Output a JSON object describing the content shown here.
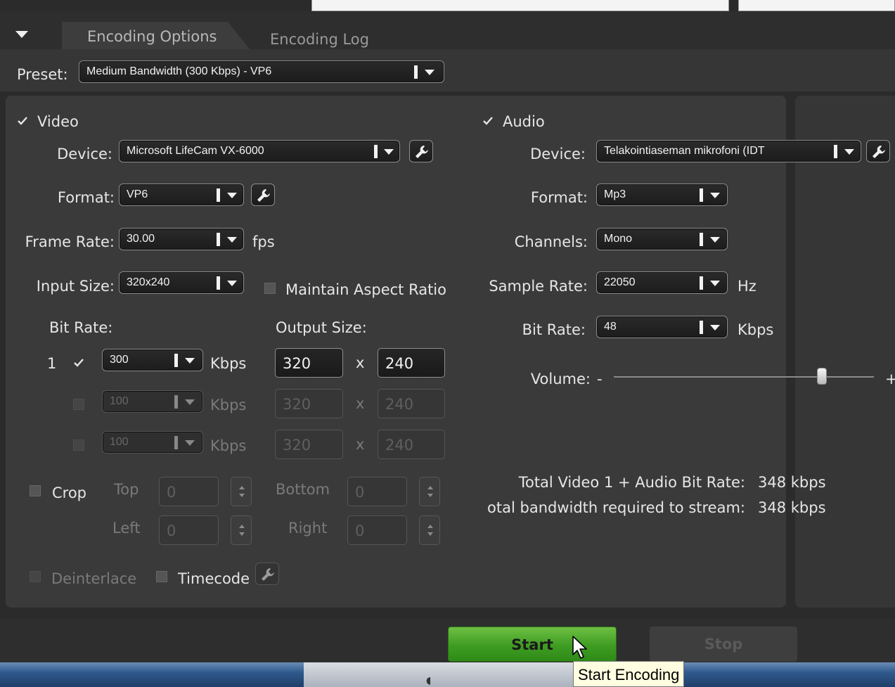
{
  "tabs": [
    {
      "label": "Encoding Options",
      "active": true
    },
    {
      "label": "Encoding Log",
      "active": false
    }
  ],
  "preset": {
    "label": "Preset:",
    "value": "Medium Bandwidth (300 Kbps) - VP6"
  },
  "video": {
    "title": "Video",
    "enabled": true,
    "device": {
      "label": "Device:",
      "value": "Microsoft LifeCam VX-6000"
    },
    "format": {
      "label": "Format:",
      "value": "VP6"
    },
    "frame_rate": {
      "label": "Frame Rate:",
      "value": "30.00",
      "unit": "fps"
    },
    "input_size": {
      "label": "Input Size:",
      "value": "320x240"
    },
    "maintain_aspect": {
      "label": "Maintain Aspect Ratio",
      "checked": false
    },
    "bit_rate_label": "Bit Rate:",
    "output_size_label": "Output Size:",
    "bitrate_rows": [
      {
        "index": "1",
        "checked": true,
        "enabled": true,
        "value": "300",
        "unit": "Kbps",
        "width": "320",
        "sep": "x",
        "height": "240"
      },
      {
        "index": "",
        "checked": false,
        "enabled": false,
        "value": "100",
        "unit": "Kbps",
        "width": "320",
        "sep": "x",
        "height": "240"
      },
      {
        "index": "",
        "checked": false,
        "enabled": false,
        "value": "100",
        "unit": "Kbps",
        "width": "320",
        "sep": "x",
        "height": "240"
      }
    ],
    "crop": {
      "label": "Crop",
      "checked": false,
      "top_label": "Top",
      "top_value": "0",
      "bottom_label": "Bottom",
      "bottom_value": "0",
      "left_label": "Left",
      "left_value": "0",
      "right_label": "Right",
      "right_value": "0"
    },
    "deinterlace": {
      "label": "Deinterlace",
      "checked": false,
      "enabled": false
    },
    "timecode": {
      "label": "Timecode",
      "checked": false
    }
  },
  "audio": {
    "title": "Audio",
    "enabled": true,
    "device": {
      "label": "Device:",
      "value": "Telakointiaseman mikrofoni (IDT"
    },
    "format": {
      "label": "Format:",
      "value": "Mp3"
    },
    "channels": {
      "label": "Channels:",
      "value": "Mono"
    },
    "sample_rate": {
      "label": "Sample Rate:",
      "value": "22050",
      "unit": "Hz"
    },
    "bit_rate": {
      "label": "Bit Rate:",
      "value": "48",
      "unit": "Kbps"
    },
    "volume": {
      "label": "Volume:",
      "minus": "-",
      "plus": "+",
      "level": 0.8
    },
    "total_label": "Total Video 1 + Audio Bit Rate:",
    "total_value": "348 kbps",
    "bandwidth_label": "otal bandwidth required to stream:",
    "bandwidth_value": "348 kbps"
  },
  "buttons": {
    "start": "Start",
    "stop": "Stop"
  },
  "tooltip": "Start Encoding",
  "colors": {
    "start_green": "#4caf2a",
    "panel": "#3a3a3a",
    "background": "#2b2b2b"
  }
}
